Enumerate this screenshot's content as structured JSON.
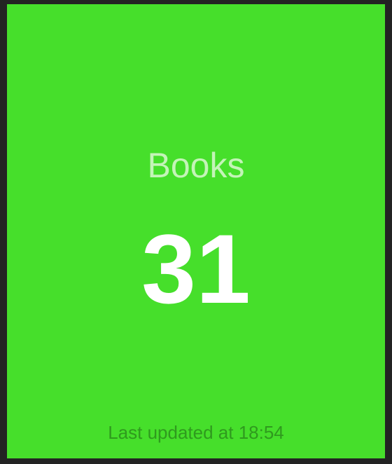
{
  "widget": {
    "title": "Books",
    "value": "31",
    "updated_text": "Last updated at 18:54",
    "colors": {
      "background": "#46df2b",
      "frame": "#232323",
      "title": "#c4f4b8",
      "value": "#ffffff",
      "updated": "#2f9a1e"
    }
  }
}
